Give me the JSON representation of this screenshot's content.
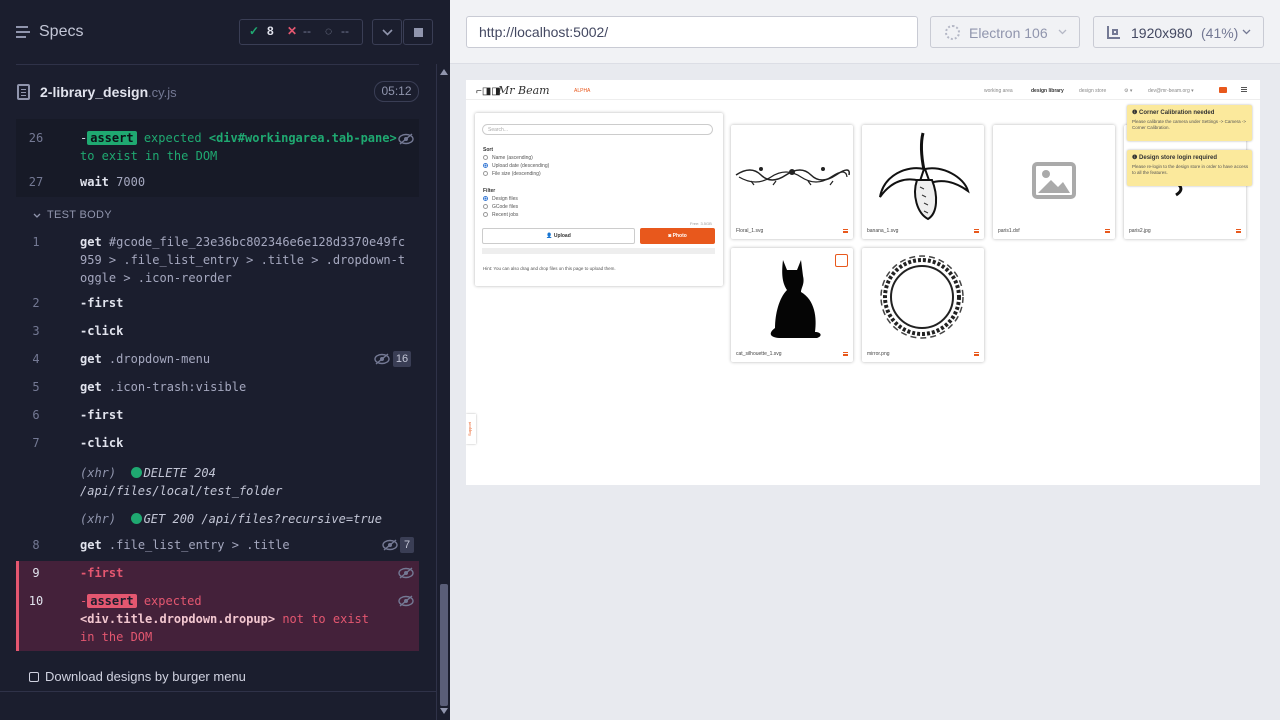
{
  "reporter": {
    "header": {
      "title": "Specs",
      "passed": "8",
      "failed": "--",
      "pending": "--"
    },
    "spec_file": {
      "name": "2-library_design",
      "ext": ".cy.js",
      "duration": "05:12"
    },
    "prehook_commands": [
      {
        "num": "26",
        "prefix": "-",
        "badge": "assert",
        "text1": "expected",
        "text2": "<div#workingarea.tab-pane>",
        "text3": "to exist in the DOM"
      },
      {
        "num": "27",
        "name": "wait",
        "arg": "7000"
      }
    ],
    "section_title": "TEST BODY",
    "commands": [
      {
        "num": "1",
        "name": "get",
        "arg": "#gcode_file_23e36bc802346e6e128d3370e49fc959 > .file_list_entry > .title > .dropdown-toggle > .icon-reorder"
      },
      {
        "num": "2",
        "name": "-first"
      },
      {
        "num": "3",
        "name": "-click"
      },
      {
        "num": "4",
        "name": "get",
        "arg": ".dropdown-menu",
        "count": "16"
      },
      {
        "num": "5",
        "name": "get",
        "arg": ".icon-trash:visible"
      },
      {
        "num": "6",
        "name": "-first"
      },
      {
        "num": "7",
        "name": "-click"
      },
      {
        "num": "8",
        "name": "get",
        "arg": ".file_list_entry > .title",
        "count": "7"
      }
    ],
    "xhr": [
      {
        "tag": "(xhr)",
        "text": "DELETE 204 /api/files/local/test_folder"
      },
      {
        "tag": "(xhr)",
        "text": "GET 200 /api/files?recursive=true"
      }
    ],
    "failed_commands": [
      {
        "num": "9",
        "name": "-first"
      },
      {
        "num": "10",
        "prefix": "-",
        "badge": "assert",
        "text1": "expected",
        "text2": "<div.title.dropdown.dropup>",
        "text3": "not to exist in the DOM"
      }
    ],
    "next_test": "Download designs by burger menu"
  },
  "aut": {
    "url": "http://localhost:5002/",
    "browser": "Electron 106",
    "viewport_size": "1920x980",
    "viewport_scale": "(41%)"
  },
  "app": {
    "logo_text": "Mr Beam",
    "alpha": "ALPHA",
    "nav": [
      "working area",
      "design library",
      "design store",
      "⚙ ▾",
      "dev@mr-beam.org ▾"
    ],
    "library": {
      "search_placeholder": "Search...",
      "sort_title": "Sort",
      "sort_options": [
        "Name (ascending)",
        "Upload date (descending)",
        "File size (descending)"
      ],
      "sort_selected": 1,
      "filter_title": "Filter",
      "filter_options": [
        "Design files",
        "GCode files",
        "Recent jobs"
      ],
      "filter_selected": 0,
      "free_space": "Free: 3.5GB",
      "upload_label": "Upload",
      "photo_label": "Photo",
      "hint": "Hint: You can also drag and drop files on this page to upload them."
    },
    "files": [
      "Floral_1.svg",
      "banana_1.svg",
      "paris1.dxf",
      "paris2.jpg",
      "cat_silhouette_1.svg",
      "mirror.png"
    ],
    "toasts": [
      {
        "title": "Corner Calibration needed",
        "body": "Please calibrate the camera under Settings -> Camera -> Corner Calibration."
      },
      {
        "title": "Design store login required",
        "body": "Please re-login to the design store in order to have access to all the features."
      }
    ],
    "support": "Support"
  },
  "colors": {
    "pass": "#1fa971",
    "fail": "#e45770",
    "accent": "#e8581c"
  }
}
